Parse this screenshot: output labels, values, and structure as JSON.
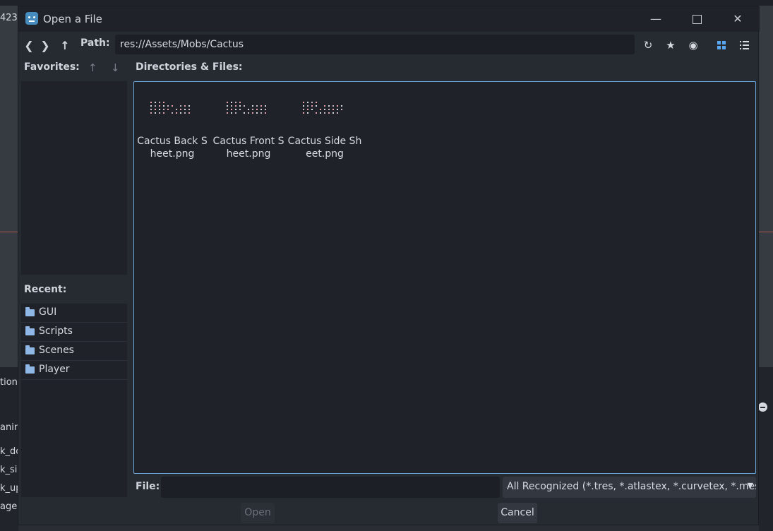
{
  "background": {
    "coord_fragment": "423.",
    "panel_fragments": [
      "tion",
      "",
      "anim",
      "k_do",
      "k_si",
      "k_up",
      "age"
    ]
  },
  "dialog": {
    "title": "Open a File",
    "path_label": "Path:",
    "path_value": "res://Assets/Mobs/Cactus",
    "favorites_label": "Favorites:",
    "recent_label": "Recent:",
    "recent_items": [
      "GUI",
      "Scripts",
      "Scenes",
      "Player"
    ],
    "files_label": "Directories & Files:",
    "files": [
      {
        "name": "Cactus Back Sheet.png"
      },
      {
        "name": "Cactus Front Sheet.png"
      },
      {
        "name": "Cactus Side Sheet.png"
      }
    ],
    "file_label": "File:",
    "file_value": "",
    "filter_value": "All Recognized (*.tres, *.atlastex, *.curvetex, *.meshte",
    "open_label": "Open",
    "cancel_label": "Cancel"
  },
  "icons": {
    "back": "chevron-left-icon",
    "forward": "chevron-right-icon",
    "up": "arrow-up-icon",
    "refresh": "refresh-icon",
    "favorite": "star-icon",
    "hidden": "eye-icon",
    "grid": "grid-view-icon",
    "list": "list-view-icon"
  },
  "colors": {
    "accent": "#6ba7dd",
    "folder": "#8fb8e6"
  }
}
